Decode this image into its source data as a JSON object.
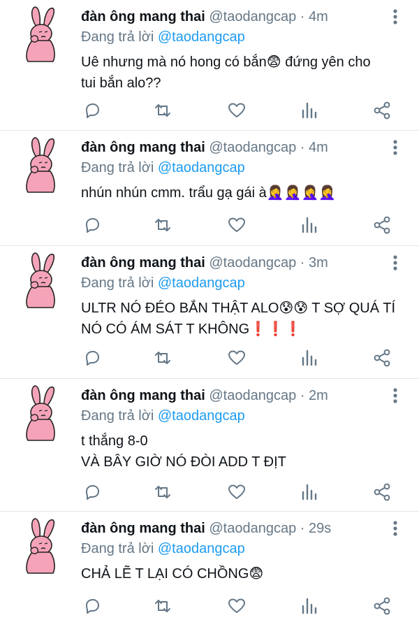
{
  "tweets": [
    {
      "author": "đàn ông mang thai",
      "handle": "@taodangcap",
      "separator": "·",
      "time": "4m",
      "replying_prefix": "Đang trả lời",
      "replying_to": "@taodangcap",
      "lines": [
        "Uê nhưng mà nó hong có bắn😨 đứng yên cho",
        "tui bắn alo??"
      ]
    },
    {
      "author": "đàn ông mang thai",
      "handle": "@taodangcap",
      "separator": "·",
      "time": "4m",
      "replying_prefix": "Đang trả lời",
      "replying_to": "@taodangcap",
      "lines": [
        "nhún nhún cmm. trẩu gạ gái à🤦‍♀️🤦‍♀️🤦‍♀️🤦‍♀️"
      ]
    },
    {
      "author": "đàn ông mang thai",
      "handle": "@taodangcap",
      "separator": "·",
      "time": "3m",
      "replying_prefix": "Đang trả lời",
      "replying_to": "@taodangcap",
      "lines": [
        "ULTR NÓ ĐÉO BẮN THẬT ALO😰😰 T SỢ QUÁ TÍ",
        "NÓ CÓ ÁM SÁT T KHÔNG❗❗❗"
      ]
    },
    {
      "author": "đàn ông mang thai",
      "handle": "@taodangcap",
      "separator": "·",
      "time": "2m",
      "replying_prefix": "Đang trả lời",
      "replying_to": "@taodangcap",
      "lines": [
        "t thắng 8-0",
        "VÀ BÂY GIỜ NÓ ĐÒI ADD T ĐỊT"
      ]
    },
    {
      "author": "đàn ông mang thai",
      "handle": "@taodangcap",
      "separator": "·",
      "time": "29s",
      "replying_prefix": "Đang trả lời",
      "replying_to": "@taodangcap",
      "lines": [
        "CHẢ LẼ T LẠI CÓ CHỒNG😨"
      ]
    }
  ],
  "colors": {
    "text": "#0f1419",
    "muted": "#657786",
    "link": "#1d9bf0",
    "avatar_fill": "#f5a3b8",
    "divider": "#e1e6ea"
  },
  "icons": [
    "reply-icon",
    "retweet-icon",
    "like-icon",
    "analytics-icon",
    "share-icon",
    "more-options-icon"
  ]
}
